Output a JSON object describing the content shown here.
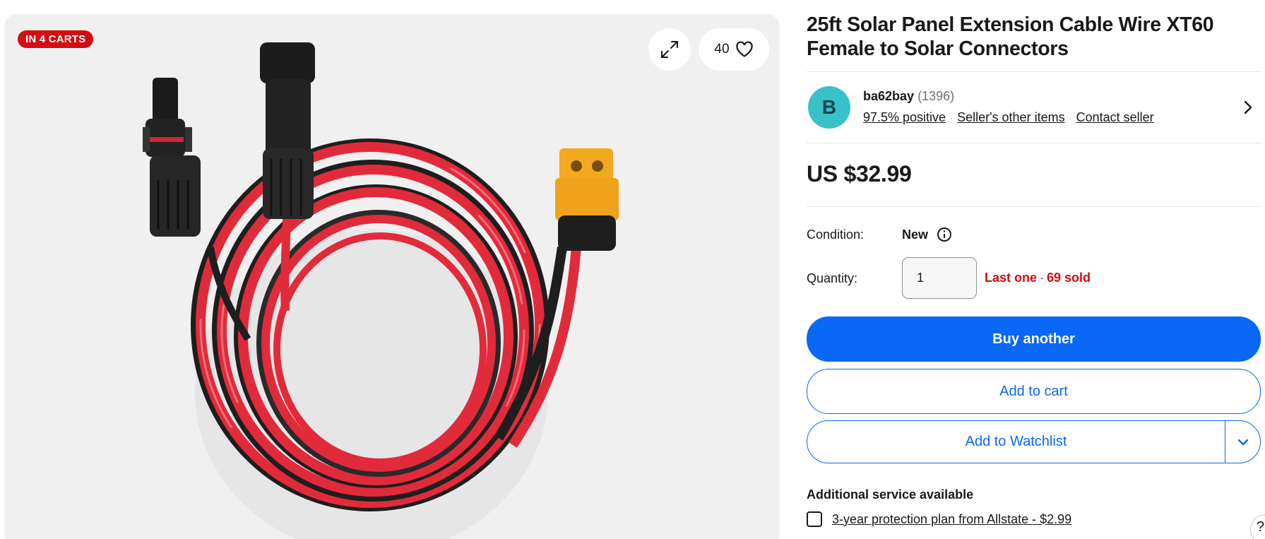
{
  "gallery": {
    "badge": "IN 4 CARTS",
    "watch_count": "40",
    "expand_icon": "expand-icon",
    "heart_icon": "heart-icon"
  },
  "listing": {
    "title": "25ft Solar Panel Extension Cable Wire XT60 Female to Solar Connectors",
    "price": "US $32.99"
  },
  "seller": {
    "avatar_initial": "B",
    "name": "ba62bay",
    "feedback_count": "(1396)",
    "positive": "97.5% positive",
    "other_items": "Seller's other items",
    "contact": "Contact seller",
    "separator": "·"
  },
  "details": {
    "condition_label": "Condition:",
    "condition_value": "New",
    "quantity_label": "Quantity:",
    "quantity_value": "1",
    "stock_status": "Last one",
    "sold": "69 sold",
    "dot": "·"
  },
  "actions": {
    "buy": "Buy another",
    "cart": "Add to cart",
    "watchlist": "Add to Watchlist"
  },
  "services": {
    "heading": "Additional service available",
    "plan": "3-year protection plan from Allstate - $2.99"
  },
  "help": {
    "label": "?"
  },
  "colors": {
    "primary": "#0968f6",
    "badge_red": "#d30d12",
    "avatar_teal": "#38c1c9",
    "cable_red": "#e12b3b",
    "connector_orange": "#f0a21c"
  }
}
